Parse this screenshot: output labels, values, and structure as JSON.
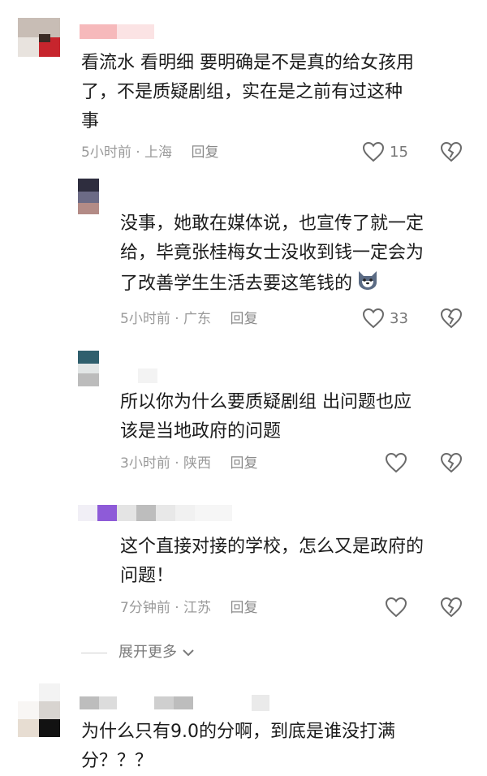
{
  "comments": [
    {
      "text_lines": [
        "看流水 看明细 要明确是不是真的给女孩用",
        "了，不是质疑剧组，实在是之前有过这种",
        "事"
      ],
      "time": "5小时前",
      "location": "上海",
      "reply_label": "回复",
      "likes": "15"
    },
    {
      "text_lines": [
        "没事，她敢在媒体说，也宣传了就一定",
        "给，毕竟张桂梅女士没收到钱一定会为",
        "了改善学生生活去要这笔钱的"
      ],
      "time": "5小时前",
      "location": "广东",
      "reply_label": "回复",
      "likes": "33"
    },
    {
      "text_lines": [
        "所以你为什么要质疑剧组  出问题也应",
        "该是当地政府的问题"
      ],
      "time": "3小时前",
      "location": "陕西",
      "reply_label": "回复",
      "likes": ""
    },
    {
      "text_lines": [
        "这个直接对接的学校，怎么又是政府的",
        "问题！"
      ],
      "time": "7分钟前",
      "location": "江苏",
      "reply_label": "回复",
      "likes": ""
    },
    {
      "text_lines": [
        "为什么只有9.0的分啊，到底是谁没打满",
        "分？？？"
      ]
    }
  ],
  "expand_label": "展开更多",
  "icons": {
    "like": "heart-outline-icon",
    "dislike": "broken-heart-icon",
    "expand": "chevron-down-icon",
    "sticker": "dog-emoji-icon"
  },
  "colors": {
    "meta": "#9a9a9a",
    "text": "#1c1c1c",
    "icon": "#6a6a6a"
  }
}
